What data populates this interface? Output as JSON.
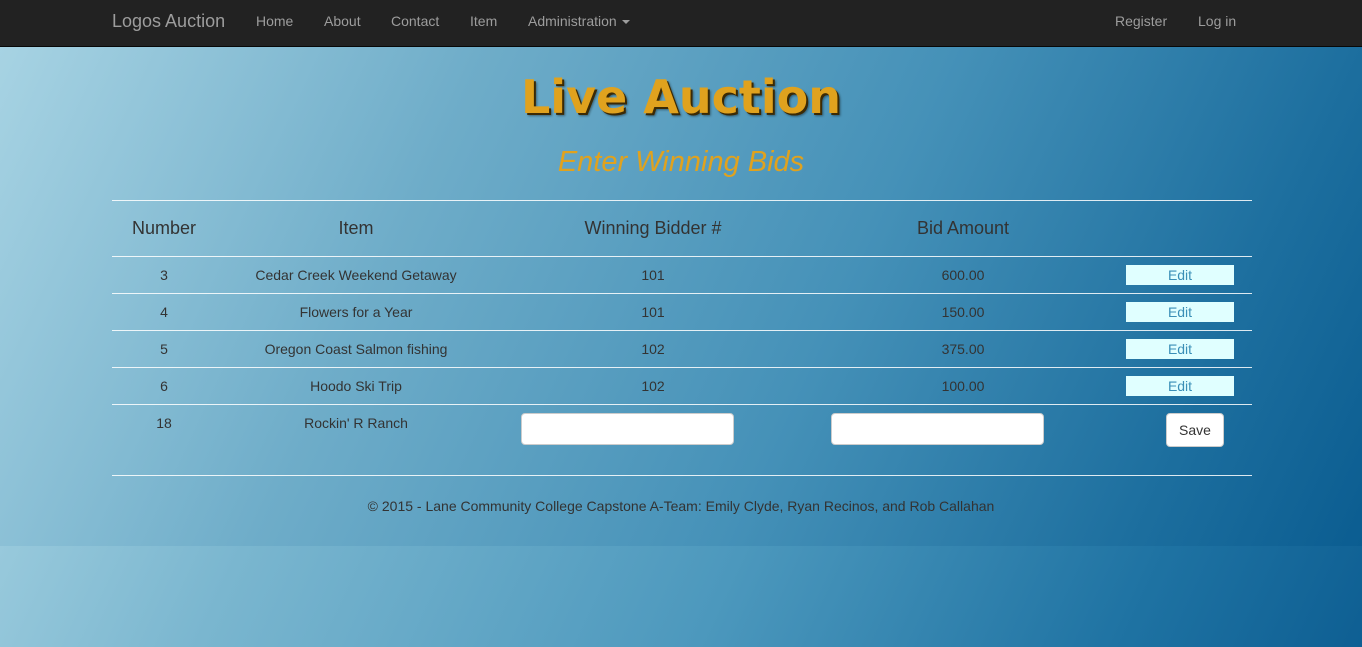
{
  "nav": {
    "brand": "Logos Auction",
    "links": [
      "Home",
      "About",
      "Contact",
      "Item",
      "Administration"
    ],
    "right_links": [
      "Register",
      "Log in"
    ]
  },
  "page": {
    "title": "Live Auction",
    "subtitle": "Enter Winning Bids"
  },
  "table": {
    "headers": [
      "Number",
      "Item",
      "Winning Bidder #",
      "Bid Amount"
    ],
    "rows": [
      {
        "number": "3",
        "item": "Cedar Creek Weekend Getaway",
        "bidder": "101",
        "amount": "600.00",
        "action": "Edit"
      },
      {
        "number": "4",
        "item": "Flowers for a Year",
        "bidder": "101",
        "amount": "150.00",
        "action": "Edit"
      },
      {
        "number": "5",
        "item": "Oregon Coast Salmon fishing",
        "bidder": "102",
        "amount": "375.00",
        "action": "Edit"
      },
      {
        "number": "6",
        "item": "Hoodo Ski Trip",
        "bidder": "102",
        "amount": "100.00",
        "action": "Edit"
      }
    ],
    "entry_row": {
      "number": "18",
      "item": "Rockin' R Ranch",
      "bidder_value": "",
      "amount_value": "",
      "save_label": "Save"
    }
  },
  "footer": {
    "text": "© 2015 - Lane Community College Capstone A-Team: Emily Clyde, Ryan Recinos, and Rob Callahan"
  },
  "colors": {
    "navbar": "#222222",
    "accent_gold": "#e0a21e",
    "edit_button_bg": "#e0ffff"
  }
}
